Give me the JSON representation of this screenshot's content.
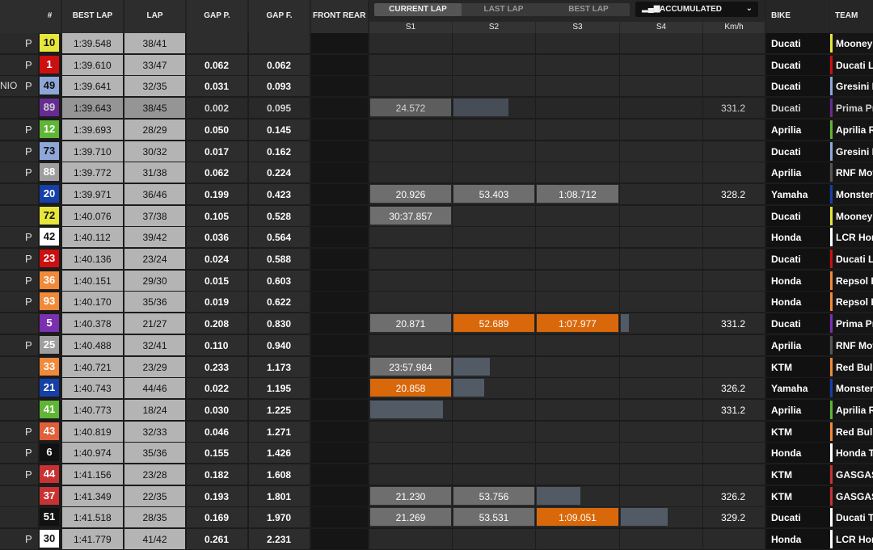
{
  "header": {
    "num": "#",
    "best_lap": "BEST LAP",
    "lap": "LAP",
    "gap_p": "GAP P.",
    "gap_f": "GAP F.",
    "front": "FRONT",
    "rear": "REAR",
    "tabs": [
      "CURRENT LAP",
      "LAST LAP",
      "BEST LAP"
    ],
    "accumulated": "ACCUMULATED",
    "s1": "S1",
    "s2": "S2",
    "s3": "S3",
    "s4": "S4",
    "kmh": "Km/h",
    "bike": "BIKE",
    "team": "TEAM"
  },
  "colors": {
    "orange": "#d9680a",
    "grey_sector": "#6e6e6e",
    "slate": "#525a65"
  },
  "rows": [
    {
      "pit": "P",
      "num": "10",
      "num_bg": "#e6e63c",
      "num_fg": "#111",
      "best": "1:39.548",
      "lap": "38/41",
      "gp": "",
      "gf": "",
      "bike": "Ducati",
      "team": "Mooney",
      "team_color": "#e6e63c"
    },
    {
      "pit": "P",
      "num": "1",
      "num_bg": "#cc1010",
      "num_fg": "#fff",
      "best": "1:39.610",
      "lap": "33/47",
      "gp": "0.062",
      "gf": "0.062",
      "bike": "Ducati",
      "team": "Ducati Le",
      "team_color": "#cc1010"
    },
    {
      "pit": "P",
      "extra": "NIO",
      "num": "49",
      "num_bg": "#8fa7d8",
      "num_fg": "#111",
      "best": "1:39.641",
      "lap": "32/35",
      "gp": "0.031",
      "gf": "0.093",
      "bike": "Ducati",
      "team": "Gresini R",
      "team_color": "#8fa7d8"
    },
    {
      "pit": "",
      "num": "89",
      "num_bg": "#7a30b0",
      "num_fg": "#fff",
      "best": "1:39.643",
      "lap": "38/45",
      "gp": "0.002",
      "gf": "0.095",
      "bike": "Ducati",
      "team": "Prima Pr",
      "team_color": "#7a30b0",
      "dim": true,
      "s1": "24.572",
      "s1_bg": "grey",
      "s2_bar": 68,
      "spd": "331.2"
    },
    {
      "pit": "P",
      "num": "12",
      "num_bg": "#5fb535",
      "num_fg": "#fff",
      "best": "1:39.693",
      "lap": "28/29",
      "gp": "0.050",
      "gf": "0.145",
      "bike": "Aprilia",
      "team": "Aprilia R",
      "team_color": "#5fb535"
    },
    {
      "pit": "P",
      "num": "73",
      "num_bg": "#8fa7d8",
      "num_fg": "#111",
      "best": "1:39.710",
      "lap": "30/32",
      "gp": "0.017",
      "gf": "0.162",
      "bike": "Ducati",
      "team": "Gresini R",
      "team_color": "#8fa7d8"
    },
    {
      "pit": "P",
      "num": "88",
      "num_bg": "#9e9e9e",
      "num_fg": "#fff",
      "best": "1:39.772",
      "lap": "31/38",
      "gp": "0.062",
      "gf": "0.224",
      "bike": "Aprilia",
      "team": "RNF Mot",
      "team_color": "#555"
    },
    {
      "pit": "",
      "num": "20",
      "num_bg": "#1540a8",
      "num_fg": "#fff",
      "best": "1:39.971",
      "lap": "36/46",
      "gp": "0.199",
      "gf": "0.423",
      "bike": "Yamaha",
      "team": "Monster",
      "team_color": "#1540a8",
      "s1": "20.926",
      "s1_bg": "grey",
      "s2": "53.403",
      "s2_bg": "grey",
      "s3": "1:08.712",
      "s3_bg": "grey",
      "spd": "328.2"
    },
    {
      "pit": "",
      "num": "72",
      "num_bg": "#e6e63c",
      "num_fg": "#111",
      "best": "1:40.076",
      "lap": "37/38",
      "gp": "0.105",
      "gf": "0.528",
      "bike": "Ducati",
      "team": "Mooney",
      "team_color": "#e6e63c",
      "s1": "30:37.857",
      "s1_bg": "grey"
    },
    {
      "pit": "P",
      "num": "42",
      "num_bg": "#ffffff",
      "num_fg": "#111",
      "best": "1:40.112",
      "lap": "39/42",
      "gp": "0.036",
      "gf": "0.564",
      "bike": "Honda",
      "team": "LCR Hon",
      "team_color": "#ffffff"
    },
    {
      "pit": "P",
      "num": "23",
      "num_bg": "#cc1010",
      "num_fg": "#fff",
      "best": "1:40.136",
      "lap": "23/24",
      "gp": "0.024",
      "gf": "0.588",
      "bike": "Ducati",
      "team": "Ducati Le",
      "team_color": "#cc1010"
    },
    {
      "pit": "P",
      "num": "36",
      "num_bg": "#f08a3a",
      "num_fg": "#fff",
      "best": "1:40.151",
      "lap": "29/30",
      "gp": "0.015",
      "gf": "0.603",
      "bike": "Honda",
      "team": "Repsol H",
      "team_color": "#f08a3a"
    },
    {
      "pit": "P",
      "num": "93",
      "num_bg": "#f08a3a",
      "num_fg": "#fff",
      "best": "1:40.170",
      "lap": "35/36",
      "gp": "0.019",
      "gf": "0.622",
      "bike": "Honda",
      "team": "Repsol H",
      "team_color": "#f08a3a"
    },
    {
      "pit": "",
      "num": "5",
      "num_bg": "#7a30b0",
      "num_fg": "#fff",
      "best": "1:40.378",
      "lap": "21/27",
      "gp": "0.208",
      "gf": "0.830",
      "bike": "Ducati",
      "team": "Prima Pr",
      "team_color": "#7a30b0",
      "s1": "20.871",
      "s1_bg": "grey",
      "s2": "52.689",
      "s2_bg": "orange",
      "s3": "1:07.977",
      "s3_bg": "orange",
      "s4_bar": 10,
      "spd": "331.2"
    },
    {
      "pit": "P",
      "num": "25",
      "num_bg": "#9e9e9e",
      "num_fg": "#fff",
      "best": "1:40.488",
      "lap": "32/41",
      "gp": "0.110",
      "gf": "0.940",
      "bike": "Aprilia",
      "team": "RNF Mot",
      "team_color": "#555"
    },
    {
      "pit": "",
      "num": "33",
      "num_bg": "#f08a3a",
      "num_fg": "#fff",
      "best": "1:40.721",
      "lap": "23/29",
      "gp": "0.233",
      "gf": "1.173",
      "bike": "KTM",
      "team": "Red Bull",
      "team_color": "#f08a3a",
      "s1": "23:57.984",
      "s1_bg": "grey",
      "s2_bar": 45
    },
    {
      "pit": "",
      "num": "21",
      "num_bg": "#1540a8",
      "num_fg": "#fff",
      "best": "1:40.743",
      "lap": "44/46",
      "gp": "0.022",
      "gf": "1.195",
      "bike": "Yamaha",
      "team": "Monster",
      "team_color": "#1540a8",
      "s1": "20.858",
      "s1_bg": "orange",
      "s2_bar": 38,
      "spd": "326.2"
    },
    {
      "pit": "",
      "num": "41",
      "num_bg": "#5fb535",
      "num_fg": "#fff",
      "best": "1:40.773",
      "lap": "18/24",
      "gp": "0.030",
      "gf": "1.225",
      "bike": "Aprilia",
      "team": "Aprilia R",
      "team_color": "#5fb535",
      "s1_bar": 90,
      "spd": "331.2"
    },
    {
      "pit": "P",
      "num": "43",
      "num_bg": "#e0603a",
      "num_fg": "#fff",
      "best": "1:40.819",
      "lap": "32/33",
      "gp": "0.046",
      "gf": "1.271",
      "bike": "KTM",
      "team": "Red Bull",
      "team_color": "#f08a3a"
    },
    {
      "pit": "P",
      "num": "6",
      "num_bg": "#111111",
      "num_fg": "#fff",
      "best": "1:40.974",
      "lap": "35/36",
      "gp": "0.155",
      "gf": "1.426",
      "bike": "Honda",
      "team": "Honda To",
      "team_color": "#ffffff"
    },
    {
      "pit": "P",
      "num": "44",
      "num_bg": "#c83232",
      "num_fg": "#fff",
      "best": "1:41.156",
      "lap": "23/28",
      "gp": "0.182",
      "gf": "1.608",
      "bike": "KTM",
      "team": "GASGAS",
      "team_color": "#c83232"
    },
    {
      "pit": "",
      "num": "37",
      "num_bg": "#c83232",
      "num_fg": "#fff",
      "best": "1:41.349",
      "lap": "22/35",
      "gp": "0.193",
      "gf": "1.801",
      "bike": "KTM",
      "team": "GASGAS",
      "team_color": "#c83232",
      "s1": "21.230",
      "s1_bg": "grey",
      "s2": "53.756",
      "s2_bg": "grey",
      "s3_bar": 53,
      "spd": "326.2"
    },
    {
      "pit": "",
      "num": "51",
      "num_bg": "#111111",
      "num_fg": "#fff",
      "best": "1:41.518",
      "lap": "28/35",
      "gp": "0.169",
      "gf": "1.970",
      "bike": "Ducati",
      "team": "Ducati To",
      "team_color": "#ffffff",
      "s1": "21.269",
      "s1_bg": "grey",
      "s2": "53.531",
      "s2_bg": "grey",
      "s3": "1:09.051",
      "s3_bg": "orange",
      "s4_bar": 58,
      "spd": "329.2"
    },
    {
      "pit": "P",
      "num": "30",
      "num_bg": "#ffffff",
      "num_fg": "#111",
      "best": "1:41.779",
      "lap": "41/42",
      "gp": "0.261",
      "gf": "2.231",
      "bike": "Honda",
      "team": "LCR Hon",
      "team_color": "#ffffff"
    }
  ]
}
